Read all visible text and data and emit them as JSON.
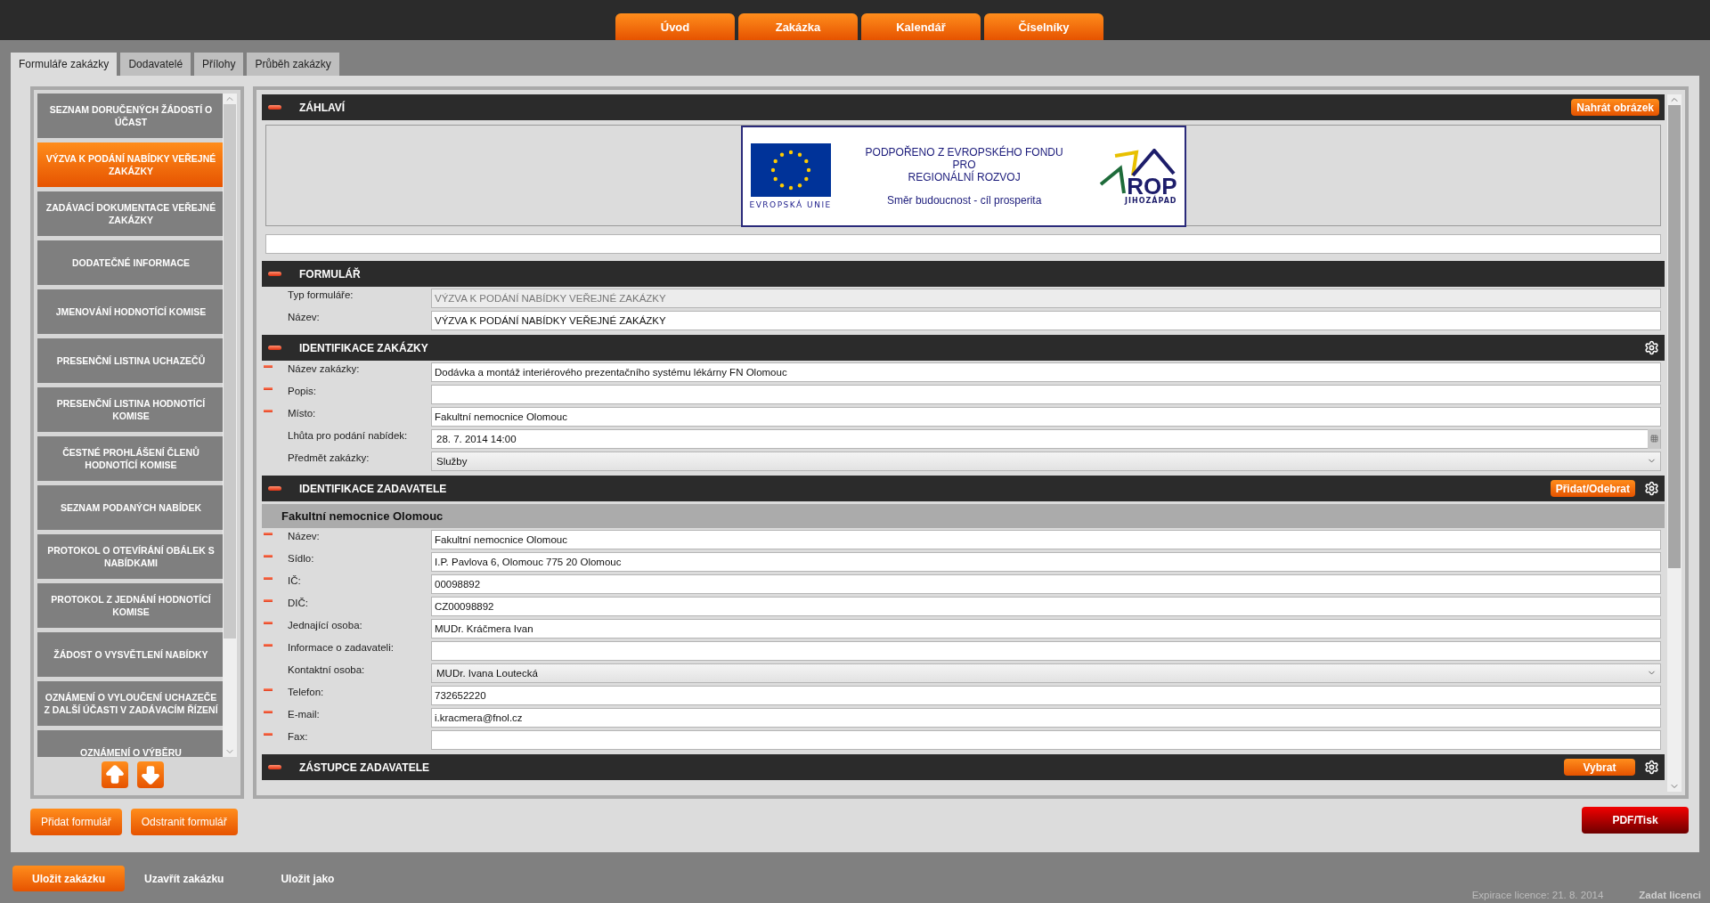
{
  "nav": [
    {
      "label": "Úvod"
    },
    {
      "label": "Zakázka"
    },
    {
      "label": "Kalendář"
    },
    {
      "label": "Číselníky"
    }
  ],
  "tabs": [
    {
      "label": "Formuláře zakázky",
      "selected": true
    },
    {
      "label": "Dodavatelé",
      "selected": false
    },
    {
      "label": "Přílohy",
      "selected": false
    },
    {
      "label": "Průběh zakázky",
      "selected": false
    }
  ],
  "form_list": {
    "items": [
      {
        "label": "SEZNAM DORUČENÝCH ŽÁDOSTÍ O ÚČAST",
        "selected": false
      },
      {
        "label": "VÝZVA K PODÁNÍ NABÍDKY VEŘEJNÉ ZAKÁZKY",
        "selected": true
      },
      {
        "label": "ZADÁVACÍ DOKUMENTACE VEŘEJNÉ ZAKÁZKY",
        "selected": false
      },
      {
        "label": "DODATEČNÉ INFORMACE",
        "selected": false
      },
      {
        "label": "JMENOVÁNÍ HODNOTÍCÍ KOMISE",
        "selected": false
      },
      {
        "label": "PRESENČNÍ LISTINA UCHAZEČŮ",
        "selected": false
      },
      {
        "label": "PRESENČNÍ LISTINA HODNOTÍCÍ KOMISE",
        "selected": false
      },
      {
        "label": "ČESTNÉ PROHLÁŠENÍ ČLENŮ HODNOTÍCÍ KOMISE",
        "selected": false
      },
      {
        "label": "SEZNAM PODANÝCH NABÍDEK",
        "selected": false
      },
      {
        "label": "PROTOKOL O OTEVÍRÁNÍ OBÁLEK S NABÍDKAMI",
        "selected": false
      },
      {
        "label": "PROTOKOL Z JEDNÁNÍ HODNOTÍCÍ KOMISE",
        "selected": false
      },
      {
        "label": "ŽÁDOST O VYSVĚTLENÍ NABÍDKY",
        "selected": false
      },
      {
        "label": "OZNÁMENÍ O VYLOUČENÍ UCHAZEČE Z DALŠÍ ÚČASTI V ZADÁVACÍM ŘÍZENÍ",
        "selected": false
      },
      {
        "label": "OZNÁMENÍ O VÝBĚRU",
        "selected": false
      }
    ]
  },
  "form_list_buttons": [
    "Přidat formulář",
    "Odstranit formulář"
  ],
  "sections": [
    {
      "title": "ZÁHLAVÍ",
      "actions": [
        {
          "kind": "button",
          "label": "Nahrát obrázek"
        }
      ],
      "banner": {
        "lines": [
          "PODPOŘENO Z EVROPSKÉHO FONDU",
          "PRO",
          "REGIONÁLNÍ ROZVOJ"
        ],
        "slogan": "Směr budoucnost - cíl prosperita",
        "eu_label": "EVROPSKÁ UNIE",
        "rop_title": "ROP",
        "rop_subtitle": "JIHOZÁPAD"
      },
      "fields": [
        {
          "kind": "text",
          "required": false
        }
      ]
    },
    {
      "title": "FORMULÁŘ",
      "fields": [
        {
          "label": "Typ formuláře:",
          "kind": "readonly",
          "required": false,
          "value": "VÝZVA K PODÁNÍ NABÍDKY VEŘEJNÉ ZAKÁZKY"
        },
        {
          "label": "Název:",
          "kind": "text",
          "required": false,
          "value": "VÝZVA K PODÁNÍ NABÍDKY VEŘEJNÉ ZAKÁZKY"
        }
      ]
    },
    {
      "title": "IDENTIFIKACE ZAKÁZKY",
      "actions": [
        {
          "kind": "gear"
        }
      ],
      "fields": [
        {
          "label": "Název zakázky:",
          "kind": "text",
          "required": true,
          "value": "Dodávka a montáž interiérového prezentačního systému lékárny FN Olomouc"
        },
        {
          "label": "Popis:",
          "kind": "text",
          "required": true
        },
        {
          "label": "Místo:",
          "kind": "text",
          "required": true,
          "value": "Fakultní nemocnice Olomouc"
        },
        {
          "label": "Lhůta pro podání nabídek:",
          "kind": "date",
          "required": false,
          "value": "28. 7. 2014 14:00"
        },
        {
          "label": "Předmět zakázky:",
          "kind": "select",
          "required": false,
          "value": "Služby"
        }
      ]
    },
    {
      "title": "IDENTIFIKACE ZADAVATELE",
      "actions": [
        {
          "kind": "button",
          "label": "Přidat/Odebrat"
        },
        {
          "kind": "gear"
        }
      ],
      "subheader": "Fakultní nemocnice Olomouc",
      "fields": [
        {
          "label": "Název:",
          "kind": "text",
          "required": true,
          "value": "Fakultní nemocnice Olomouc"
        },
        {
          "label": "Sídlo:",
          "kind": "text",
          "required": true,
          "value": "I.P. Pavlova 6, Olomouc 775 20 Olomouc"
        },
        {
          "label": "IČ:",
          "kind": "text",
          "required": true,
          "value": "00098892"
        },
        {
          "label": "DIČ:",
          "kind": "text",
          "required": true,
          "value": "CZ00098892"
        },
        {
          "label": "Jednající osoba:",
          "kind": "text",
          "required": true,
          "value": "MUDr. Kráčmera Ivan"
        },
        {
          "label": "Informace o zadavateli:",
          "kind": "text",
          "required": true
        },
        {
          "label": "Kontaktní osoba:",
          "kind": "select",
          "required": false,
          "value": "MUDr. Ivana Loutecká"
        },
        {
          "label": "Telefon:",
          "kind": "text",
          "required": true,
          "value": "732652220"
        },
        {
          "label": "E-mail:",
          "kind": "text",
          "required": true,
          "value": "i.kracmera@fnol.cz"
        },
        {
          "label": "Fax:",
          "kind": "text",
          "required": true
        }
      ]
    },
    {
      "title": "ZÁSTUPCE ZADAVATELE",
      "actions": [
        {
          "kind": "button",
          "label": "Vybrat"
        },
        {
          "kind": "gear"
        }
      ]
    }
  ],
  "print_button": "PDF/Tisk",
  "footer": {
    "buttons": [
      {
        "label": "Uložit zakázku",
        "kind": "primary"
      },
      {
        "label": "Uzavřít zakázku",
        "kind": "plain"
      },
      {
        "label": "Uložit jako",
        "kind": "plain"
      }
    ],
    "license": "Expirace licence: 21. 8. 2014",
    "license_link": "Zadat licenci"
  }
}
